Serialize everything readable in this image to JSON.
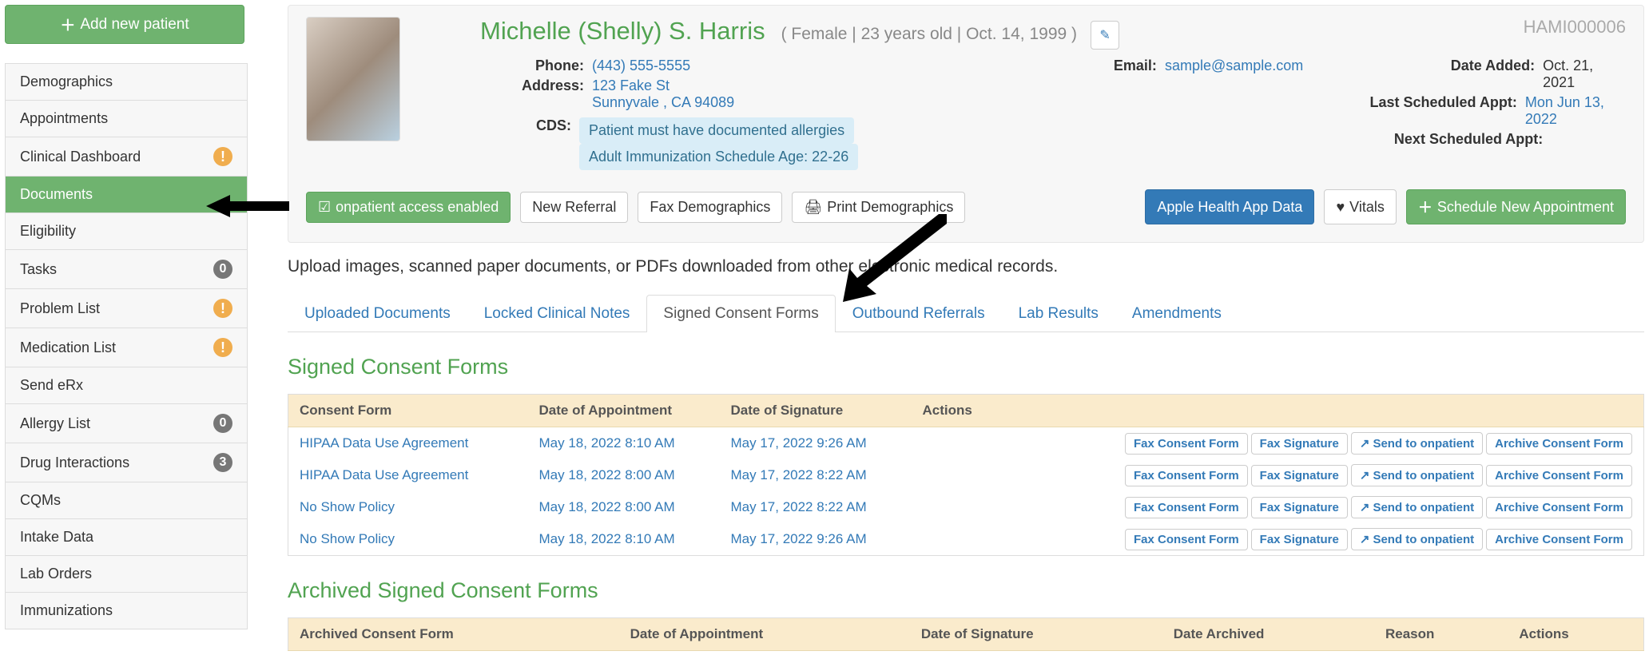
{
  "sidebar": {
    "add_patient": "Add new patient",
    "items": [
      {
        "label": "Demographics"
      },
      {
        "label": "Appointments"
      },
      {
        "label": "Clinical Dashboard",
        "warn": true
      },
      {
        "label": "Documents",
        "active": true
      },
      {
        "label": "Eligibility"
      },
      {
        "label": "Tasks",
        "count": "0"
      },
      {
        "label": "Problem List",
        "warn": true
      },
      {
        "label": "Medication List",
        "warn": true
      },
      {
        "label": "Send eRx"
      },
      {
        "label": "Allergy List",
        "count": "0"
      },
      {
        "label": "Drug Interactions",
        "count": "3"
      },
      {
        "label": "CQMs"
      },
      {
        "label": "Intake Data"
      },
      {
        "label": "Lab Orders"
      },
      {
        "label": "Immunizations"
      }
    ]
  },
  "patient": {
    "name": "Michelle (Shelly) S. Harris",
    "demo": "( Female | 23 years old | Oct. 14, 1999 )",
    "id": "HAMI000006",
    "phone_label": "Phone:",
    "phone": "(443) 555-5555",
    "email_label": "Email:",
    "email": "sample@sample.com",
    "address_label": "Address:",
    "address1": "123 Fake St",
    "address2": "Sunnyvale , CA 94089",
    "cds_label": "CDS:",
    "cds1": "Patient must have documented allergies",
    "cds2": "Adult Immunization Schedule Age: 22-26",
    "date_added_label": "Date Added:",
    "date_added": "Oct. 21, 2021",
    "last_appt_label": "Last Scheduled Appt:",
    "last_appt": "Mon Jun 13, 2022",
    "next_appt_label": "Next Scheduled Appt:",
    "next_appt": ""
  },
  "actions": {
    "onpatient": "onpatient access enabled",
    "new_referral": "New Referral",
    "fax_demo": "Fax Demographics",
    "print_demo": "Print Demographics",
    "apple": "Apple Health App Data",
    "vitals": "Vitals",
    "schedule": "Schedule New Appointment"
  },
  "instructions": "Upload images, scanned paper documents, or PDFs downloaded from other electronic medical records.",
  "tabs": {
    "uploaded": "Uploaded Documents",
    "locked": "Locked Clinical Notes",
    "signed": "Signed Consent Forms",
    "outbound": "Outbound Referrals",
    "lab": "Lab Results",
    "amend": "Amendments"
  },
  "section1_title": "Signed Consent Forms",
  "table1": {
    "h1": "Consent Form",
    "h2": "Date of Appointment",
    "h3": "Date of Signature",
    "h4": "Actions",
    "rows": [
      {
        "form": "HIPAA Data Use Agreement",
        "appt": "May 18, 2022 8:10 AM",
        "sig": "May 17, 2022 9:26 AM"
      },
      {
        "form": "HIPAA Data Use Agreement",
        "appt": "May 18, 2022 8:00 AM",
        "sig": "May 17, 2022 8:22 AM"
      },
      {
        "form": "No Show Policy",
        "appt": "May 18, 2022 8:00 AM",
        "sig": "May 17, 2022 8:22 AM"
      },
      {
        "form": "No Show Policy",
        "appt": "May 18, 2022 8:10 AM",
        "sig": "May 17, 2022 9:26 AM"
      }
    ]
  },
  "row_actions": {
    "fax_form": "Fax Consent Form",
    "fax_sig": "Fax Signature",
    "send": "Send to onpatient",
    "archive": "Archive Consent Form"
  },
  "section2_title": "Archived Signed Consent Forms",
  "table2": {
    "h1": "Archived Consent Form",
    "h2": "Date of Appointment",
    "h3": "Date of Signature",
    "h4": "Date Archived",
    "h5": "Reason",
    "h6": "Actions"
  }
}
